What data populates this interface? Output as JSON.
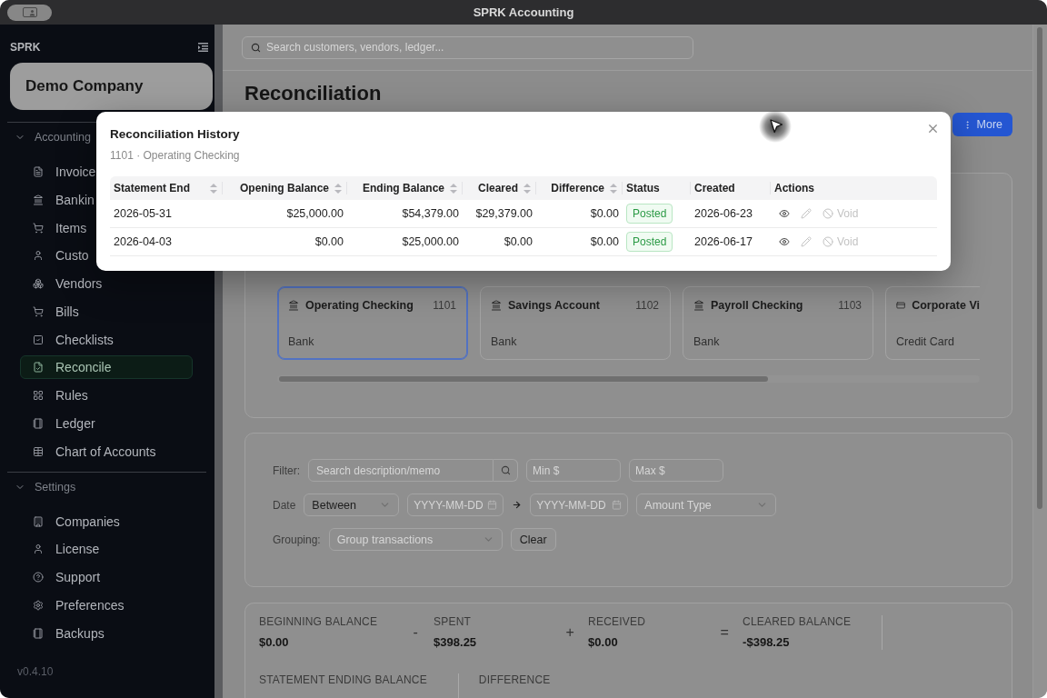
{
  "window": {
    "title": "SPRK Accounting"
  },
  "sidebar": {
    "brand": "SPRK",
    "company": "Demo Company",
    "sections": [
      {
        "title": "Accounting",
        "expanded": true,
        "items": [
          {
            "label": "Invoice",
            "selected": false
          },
          {
            "label": "Bankin",
            "selected": false
          },
          {
            "label": "Items",
            "selected": false
          },
          {
            "label": "Custo",
            "selected": false
          },
          {
            "label": "Vendors",
            "selected": false
          },
          {
            "label": "Bills",
            "selected": false
          },
          {
            "label": "Checklists",
            "selected": false
          },
          {
            "label": "Reconcile",
            "selected": true
          },
          {
            "label": "Rules",
            "selected": false
          },
          {
            "label": "Ledger",
            "selected": false
          },
          {
            "label": "Chart of Accounts",
            "selected": false
          }
        ]
      },
      {
        "title": "Settings",
        "expanded": true,
        "items": [
          {
            "label": "Companies",
            "selected": false
          },
          {
            "label": "License",
            "selected": false
          },
          {
            "label": "Support",
            "selected": false
          },
          {
            "label": "Preferences",
            "selected": false
          },
          {
            "label": "Backups",
            "selected": false
          }
        ]
      }
    ],
    "version": "v0.4.10"
  },
  "topbar": {
    "search": {
      "placeholder": "Search customers, vendors, ledger..."
    }
  },
  "page": {
    "title": "Reconciliation",
    "actions": [
      {
        "label": "More"
      }
    ]
  },
  "accounts": [
    {
      "kind": "bank",
      "name": "Operating Checking",
      "number": "1101",
      "type": "Bank",
      "selected": true
    },
    {
      "kind": "bank",
      "name": "Savings Account",
      "number": "1102",
      "type": "Bank",
      "selected": false
    },
    {
      "kind": "bank",
      "name": "Payroll Checking",
      "number": "1103",
      "type": "Bank",
      "selected": false
    },
    {
      "kind": "credit_card",
      "name": "Corporate Vi",
      "type": "Credit Card",
      "selected": false
    }
  ],
  "filters": {
    "rows": [
      {
        "label": "Filter:",
        "controls": [
          {
            "kind": "search",
            "placeholder": "Search description/memo"
          },
          {
            "kind": "input",
            "placeholder": "Min $"
          },
          {
            "kind": "input",
            "placeholder": "Max $"
          }
        ]
      },
      {
        "label": "Date",
        "controls": [
          {
            "kind": "select",
            "value": "Between"
          },
          {
            "kind": "date",
            "placeholder": "YYYY-MM-DD"
          },
          {
            "kind": "arrow"
          },
          {
            "kind": "date",
            "placeholder": "YYYY-MM-DD"
          },
          {
            "kind": "select",
            "placeholder": "Amount Type"
          }
        ]
      },
      {
        "label": "Grouping:",
        "controls": [
          {
            "kind": "select",
            "placeholder": "Group transactions"
          },
          {
            "kind": "button",
            "label": "Clear"
          }
        ]
      }
    ]
  },
  "summary": {
    "rows": [
      {
        "items": [
          {
            "kind": "term",
            "label": "BEGINNING BALANCE",
            "value": "$0.00"
          },
          {
            "kind": "operator",
            "sign": "-"
          },
          {
            "kind": "term",
            "label": "SPENT",
            "value": "$398.25"
          },
          {
            "kind": "operator",
            "sign": "+"
          },
          {
            "kind": "term",
            "label": "RECEIVED",
            "value": "$0.00"
          },
          {
            "kind": "operator",
            "sign": "="
          },
          {
            "kind": "term",
            "label": "CLEARED BALANCE",
            "value": "-$398.25"
          },
          {
            "kind": "divider"
          }
        ]
      },
      {
        "items": [
          {
            "kind": "term",
            "label": "STATEMENT ENDING BALANCE"
          },
          {
            "kind": "divider"
          },
          {
            "kind": "term",
            "label": "DIFFERENCE"
          }
        ]
      }
    ]
  },
  "dialog": {
    "title": "Reconciliation History",
    "subtitle": "1101 · Operating Checking",
    "columns": [
      {
        "label": "Statement End",
        "kind": "date",
        "sortable": true
      },
      {
        "label": "Opening Balance",
        "kind": "money",
        "sortable": true
      },
      {
        "label": "Ending Balance",
        "kind": "money",
        "sortable": true
      },
      {
        "label": "Cleared",
        "kind": "money",
        "sortable": true
      },
      {
        "label": "Difference",
        "kind": "money",
        "sortable": true
      },
      {
        "label": "Status",
        "kind": "status",
        "sortable": false
      },
      {
        "label": "Created",
        "kind": "date",
        "sortable": false
      },
      {
        "label": "Actions",
        "kind": "actions",
        "sortable": false
      }
    ],
    "rows": [
      {
        "cells": [
          "2026-05-31",
          "$25,000.00",
          "$54,379.00",
          "$29,379.00",
          "$0.00",
          "Posted",
          "2026-06-23"
        ],
        "actions": [
          {
            "kind": "view",
            "disabled": false
          },
          {
            "kind": "edit",
            "disabled": true
          },
          {
            "kind": "void",
            "label": "Void",
            "disabled": true
          }
        ]
      },
      {
        "cells": [
          "2026-04-03",
          "$0.00",
          "$25,000.00",
          "$0.00",
          "$0.00",
          "Posted",
          "2026-06-17"
        ],
        "actions": [
          {
            "kind": "view",
            "disabled": false
          },
          {
            "kind": "edit",
            "disabled": true
          },
          {
            "kind": "void",
            "label": "Void",
            "disabled": true
          }
        ]
      }
    ]
  }
}
